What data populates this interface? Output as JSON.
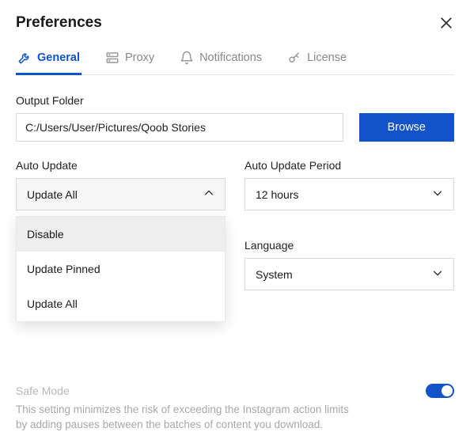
{
  "window": {
    "title": "Preferences"
  },
  "tabs": [
    {
      "label": "General",
      "active": true
    },
    {
      "label": "Proxy",
      "active": false
    },
    {
      "label": "Notifications",
      "active": false
    },
    {
      "label": "License",
      "active": false
    }
  ],
  "output": {
    "label": "Output Folder",
    "value": "C:/Users/User/Pictures/Qoob Stories",
    "browse_label": "Browse"
  },
  "auto_update": {
    "label": "Auto Update",
    "selected": "Update All",
    "options": [
      "Disable",
      "Update Pinned",
      "Update All"
    ],
    "highlighted_index": 0
  },
  "auto_update_period": {
    "label": "Auto Update Period",
    "selected": "12 hours"
  },
  "language": {
    "label": "Language",
    "selected": "System"
  },
  "safe_mode": {
    "label": "Safe Mode",
    "enabled": true,
    "description": "This setting minimizes the risk of exceeding the Instagram action limits by adding pauses between the batches of content you download."
  }
}
